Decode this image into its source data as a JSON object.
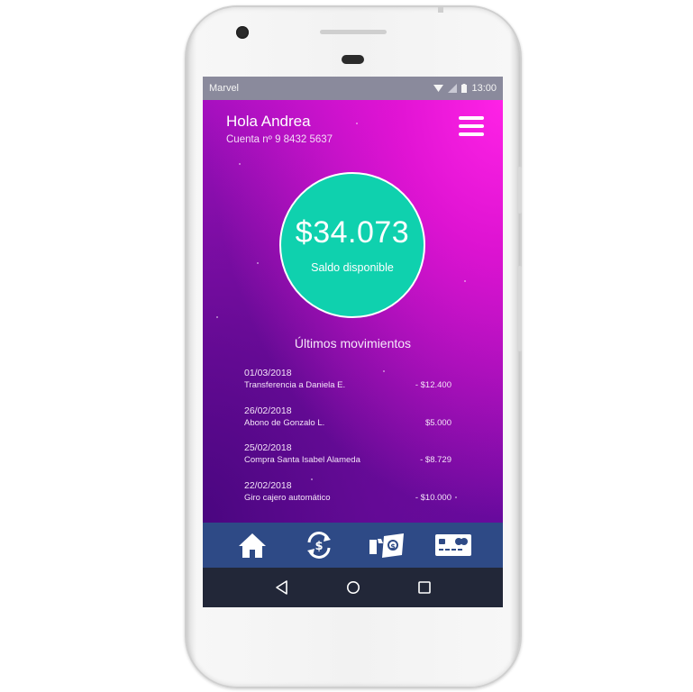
{
  "statusbar": {
    "carrier": "Marvel",
    "time": "13:00"
  },
  "header": {
    "greeting": "Hola Andrea",
    "account": "Cuenta nº 9 8432 5637",
    "menu_icon": "hamburger-icon"
  },
  "balance": {
    "amount": "$34.073",
    "label": "Saldo disponible"
  },
  "movements": {
    "title": "Últimos movimientos",
    "items": [
      {
        "date": "01/03/2018",
        "description": "Transferencia a Daniela E.",
        "amount": "- $12.400"
      },
      {
        "date": "26/02/2018",
        "description": "Abono de Gonzalo L.",
        "amount": "$5.000"
      },
      {
        "date": "25/02/2018",
        "description": "Compra Santa Isabel Alameda",
        "amount": "- $8.729"
      },
      {
        "date": "22/02/2018",
        "description": "Giro cajero automático",
        "amount": "- $10.000"
      }
    ]
  },
  "tabbar": {
    "tabs": [
      {
        "icon": "home-icon"
      },
      {
        "icon": "exchange-money-icon"
      },
      {
        "icon": "payment-icon"
      },
      {
        "icon": "credit-card-icon"
      }
    ]
  },
  "navbar": {
    "buttons": [
      {
        "icon": "back-triangle-icon"
      },
      {
        "icon": "home-circle-icon"
      },
      {
        "icon": "recents-square-icon"
      }
    ]
  },
  "colors": {
    "accent": "#0fd1ae",
    "tabbar": "#2e4a86",
    "navbar": "#222738",
    "gradient_top": "#ff22e6",
    "gradient_bottom": "#6a0aa0"
  }
}
